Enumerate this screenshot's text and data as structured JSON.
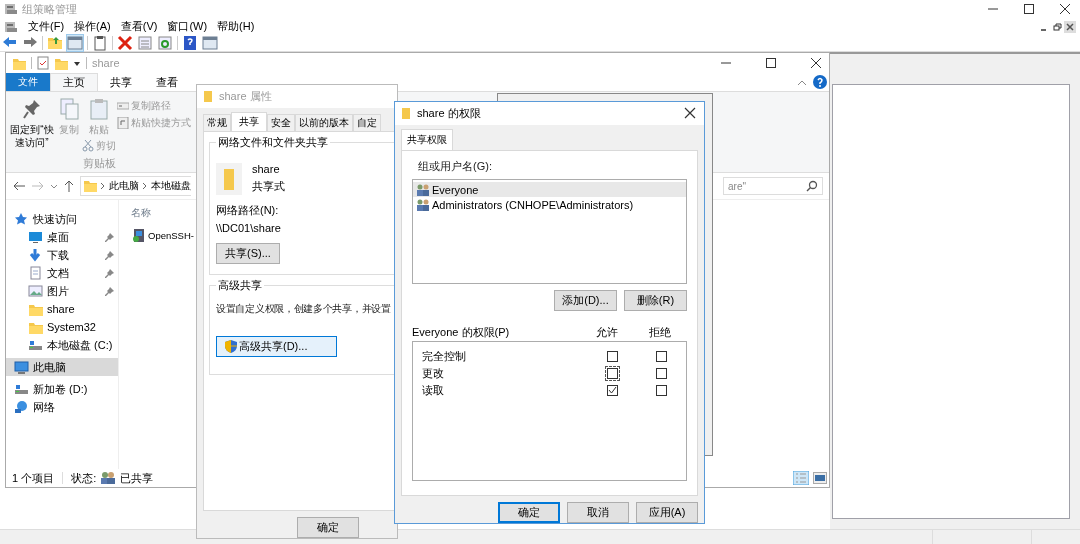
{
  "main_window": {
    "title": "组策略管理",
    "menu": [
      "文件(F)",
      "操作(A)",
      "查看(V)",
      "窗口(W)",
      "帮助(H)"
    ]
  },
  "explorer": {
    "title": "share",
    "ribbon_tabs": [
      {
        "label": "文件",
        "kind": "file",
        "selected": false
      },
      {
        "label": "主页",
        "kind": "tab",
        "selected": true
      },
      {
        "label": "共享",
        "kind": "tab",
        "selected": false
      },
      {
        "label": "查看",
        "kind": "tab",
        "selected": false
      }
    ],
    "clipboard_group": {
      "pin": "固定到“快速访问”",
      "copy": "复制",
      "paste": "粘贴",
      "copy_path": "复制路径",
      "paste_shortcut": "粘贴快捷方式",
      "cut": "剪切",
      "label": "剪贴板"
    },
    "breadcrumb": [
      "此电脑",
      "本地磁盘"
    ],
    "search": {
      "placeholder": "are\""
    },
    "nav": [
      {
        "label": "快速访问",
        "kind": "star",
        "selected": false,
        "children": [
          {
            "label": "桌面",
            "kind": "desktop",
            "pinned": true
          },
          {
            "label": "下载",
            "kind": "download",
            "pinned": true
          },
          {
            "label": "文档",
            "kind": "document",
            "pinned": true
          },
          {
            "label": "图片",
            "kind": "pictures",
            "pinned": true
          },
          {
            "label": "share",
            "kind": "folder",
            "pinned": false
          },
          {
            "label": "System32",
            "kind": "folder",
            "pinned": false
          },
          {
            "label": "本地磁盘 (C:)",
            "kind": "drive",
            "pinned": false
          }
        ]
      },
      {
        "label": "此电脑",
        "kind": "computer",
        "selected": true
      },
      {
        "label": "新加卷 (D:)",
        "kind": "drive",
        "selected": false
      },
      {
        "label": "网络",
        "kind": "network",
        "selected": false
      }
    ],
    "column": "名称",
    "files": [
      "OpenSSH-"
    ],
    "status": {
      "count": "1 个项目",
      "state_label": "状态:",
      "state": "已共享"
    }
  },
  "properties_dialog": {
    "title": "share 属性",
    "tabs": [
      {
        "label": "常规",
        "selected": false
      },
      {
        "label": "共享",
        "selected": true
      },
      {
        "label": "安全",
        "selected": false
      },
      {
        "label": "以前的版本",
        "selected": false
      },
      {
        "label": "自定",
        "selected": false
      }
    ],
    "share_group": {
      "title": "网络文件和文件夹共享",
      "name": "share",
      "state": "共享式",
      "path_label": "网络路径(N):",
      "path": "\\\\DC01\\share",
      "button": "共享(S)..."
    },
    "advanced_group": {
      "title": "高级共享",
      "text": "设置自定义权限，创建多个共享，并设置",
      "button": "高级共享(D)..."
    },
    "buttons": [
      "确定"
    ]
  },
  "permissions_dialog": {
    "title": "share 的权限",
    "tab": "共享权限",
    "users_label": "组或用户名(G):",
    "users": [
      {
        "name": "Everyone",
        "selected": true
      },
      {
        "name": "Administrators (CNHOPE\\Administrators)",
        "selected": false
      }
    ],
    "buttons": [
      "添加(D)...",
      "删除(R)"
    ],
    "permissions_label": "Everyone 的权限(P)",
    "columns": [
      "允许",
      "拒绝"
    ],
    "permissions": [
      {
        "name": "完全控制",
        "allow": false,
        "deny": false,
        "focused": false
      },
      {
        "name": "更改",
        "allow": false,
        "deny": false,
        "focused": true
      },
      {
        "name": "读取",
        "allow": true,
        "deny": false,
        "focused": false
      }
    ],
    "footer_buttons": [
      {
        "label": "确定",
        "default": true
      },
      {
        "label": "取消",
        "default": false
      },
      {
        "label": "应用(A)",
        "default": false
      }
    ]
  }
}
